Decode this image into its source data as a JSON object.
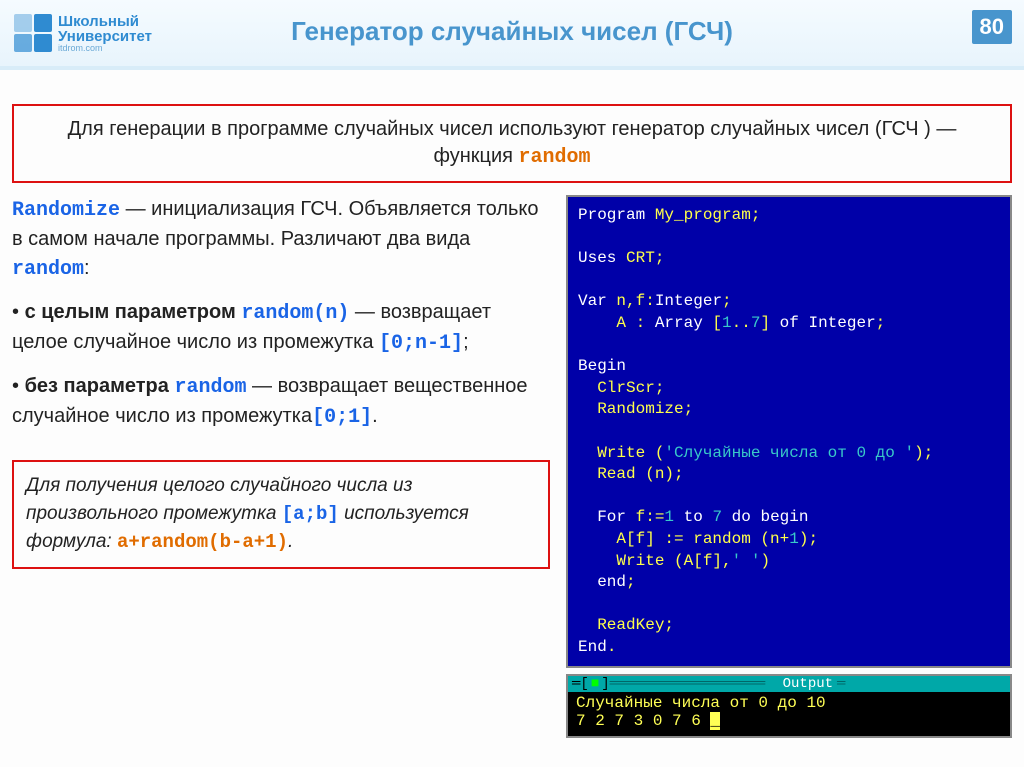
{
  "header": {
    "logo_line1": "Школьный",
    "logo_line2": "Университет",
    "logo_sub": "itdrom.com",
    "title": "Генератор случайных чисел  (ГСЧ)",
    "page": "80"
  },
  "intro": {
    "text_a": "Для генерации в программе случайных чисел используют генератор случайных чисел (ГСЧ ) — функция ",
    "kw": "random"
  },
  "left": {
    "p1_kw": "Randomize",
    "p1_a": "  —   инициализация ГСЧ. Объявляется только в самом начале программы. Различают два вида ",
    "p1_kw2": "random",
    "p1_b": ":",
    "b1_pre": "• ",
    "b1_bold": "с целым параметром ",
    "b1_kw": "random(n)",
    "b1_a": " — возвращает целое случайное число из промежутка ",
    "b1_int": "[0;n-1]",
    "b1_tail": ";",
    "b2_pre": "• ",
    "b2_bold": "без параметра ",
    "b2_kw": "random",
    "b2_a": " — возвращает вещественное случайное число из промежутка",
    "b2_int": "[0;1]",
    "b2_tail": "."
  },
  "formula": {
    "a": "Для получения целого случайного числа из произвольного промежутка ",
    "int": "[a;b]",
    "b": " используется формула: ",
    "expr": "a+random(b-a+1)",
    "tail": "."
  },
  "code": {
    "l1a": "Program",
    "l1b": " My_program;",
    "l2a": "Uses",
    "l2b": " CRT;",
    "l3a": "Var",
    "l3b": " n,f:",
    "l3c": "Integer",
    "l3d": ";",
    "l4a": "    A : ",
    "l4b": "Array",
    "l4c": " [",
    "l4d": "1",
    "l4e": "..",
    "l4f": "7",
    "l4g": "] ",
    "l4h": "of",
    "l4i": " Integer",
    "l4j": ";",
    "l5": "Begin",
    "l6": "  ClrScr;",
    "l7": "  Randomize;",
    "l8a": "  Write (",
    "l8b": "'Случайные числа от 0 до '",
    "l8c": ");",
    "l9": "  Read (n);",
    "l10a": "  For",
    "l10b": " f:=",
    "l10c": "1",
    "l10d": " to",
    "l10e": " 7",
    "l10f": " do",
    "l10g": " begin",
    "l11a": "    A[f] := random (n+",
    "l11b": "1",
    "l11c": ");",
    "l12a": "    Write (A[f],",
    "l12b": "' '",
    "l12c": ")",
    "l13a": "  end",
    "l13b": ";",
    "l14": "  ReadKey;",
    "l15a": "End",
    "l15b": "."
  },
  "output": {
    "label": "Output",
    "line1": "Случайные числа от 0 до 10",
    "line2": "7 2 7 3 0 7 6 "
  }
}
